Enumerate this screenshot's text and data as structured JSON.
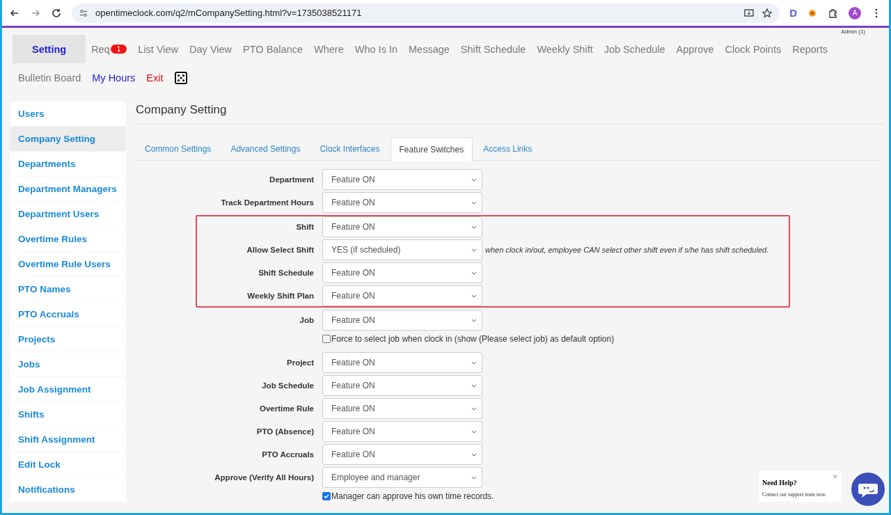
{
  "browser": {
    "url": "opentimeclock.com/q2/mCompanySetting.html?v=1735038521171",
    "extension_letter": "D",
    "avatar_letter": "A"
  },
  "account": "Admin (1)",
  "nav": [
    {
      "label": "Setting",
      "selected": true,
      "kind": "tab"
    },
    {
      "label": "Req",
      "selected": false,
      "kind": "tab",
      "badge": "1"
    },
    {
      "label": "List View",
      "selected": false,
      "kind": "tab"
    },
    {
      "label": "Day View",
      "selected": false,
      "kind": "tab"
    },
    {
      "label": "PTO Balance",
      "selected": false,
      "kind": "tab"
    },
    {
      "label": "Where",
      "selected": false,
      "kind": "tab"
    },
    {
      "label": "Who Is In",
      "selected": false,
      "kind": "tab"
    },
    {
      "label": "Message",
      "selected": false,
      "kind": "tab"
    },
    {
      "label": "Shift Schedule",
      "selected": false,
      "kind": "tab"
    },
    {
      "label": "Weekly Shift",
      "selected": false,
      "kind": "tab"
    },
    {
      "label": "Job Schedule",
      "selected": false,
      "kind": "tab"
    },
    {
      "label": "Approve",
      "selected": false,
      "kind": "tab"
    },
    {
      "label": "Clock Points",
      "selected": false,
      "kind": "tab"
    },
    {
      "label": "Reports",
      "selected": false,
      "kind": "tab"
    },
    {
      "label": "Bulletin Board",
      "selected": false,
      "kind": "tab"
    },
    {
      "label": "My Hours",
      "selected": false,
      "kind": "mine"
    },
    {
      "label": "Exit",
      "selected": false,
      "kind": "exit"
    },
    {
      "kind": "icon",
      "selected": false
    }
  ],
  "sidebar": {
    "items": [
      {
        "label": "Users",
        "selected": false
      },
      {
        "label": "Company Setting",
        "selected": true
      },
      {
        "label": "Departments",
        "selected": false
      },
      {
        "label": "Department Managers",
        "selected": false
      },
      {
        "label": "Department Users",
        "selected": false
      },
      {
        "label": "Overtime Rules",
        "selected": false
      },
      {
        "label": "Overtime Rule Users",
        "selected": false
      },
      {
        "label": "PTO Names",
        "selected": false
      },
      {
        "label": "PTO Accruals",
        "selected": false
      },
      {
        "label": "Projects",
        "selected": false
      },
      {
        "label": "Jobs",
        "selected": false
      },
      {
        "label": "Job Assignment",
        "selected": false
      },
      {
        "label": "Shifts",
        "selected": false
      },
      {
        "label": "Shift Assignment",
        "selected": false
      },
      {
        "label": "Edit Lock",
        "selected": false
      },
      {
        "label": "Notifications",
        "selected": false
      }
    ]
  },
  "page_title": "Company Setting",
  "tabs": [
    {
      "label": "Common Settings",
      "selected": false
    },
    {
      "label": "Advanced Settings",
      "selected": false
    },
    {
      "label": "Clock Interfaces",
      "selected": false
    },
    {
      "label": "Feature Switches",
      "selected": true
    },
    {
      "label": "Access Links",
      "selected": false
    }
  ],
  "sections": [
    {
      "highlighted": false,
      "rows": [
        {
          "kind": "select",
          "label": "Department",
          "value": "Feature ON"
        },
        {
          "kind": "select",
          "label": "Track Department Hours",
          "value": "Feature ON"
        }
      ]
    },
    {
      "highlighted": true,
      "rows": [
        {
          "kind": "select",
          "label": "Shift",
          "value": "Feature ON"
        },
        {
          "kind": "select",
          "label": "Allow Select Shift",
          "value": "YES (if scheduled)",
          "note": "when clock in/out, employee CAN select other shift even if s/he has shift scheduled."
        },
        {
          "kind": "select",
          "label": "Shift Schedule",
          "value": "Feature ON"
        },
        {
          "kind": "select",
          "label": "Weekly Shift Plan",
          "value": "Feature ON"
        }
      ]
    },
    {
      "highlighted": false,
      "rows": [
        {
          "kind": "select",
          "label": "Job",
          "value": "Feature ON"
        },
        {
          "kind": "checkbox",
          "label": "Force to select job when clock in (show (Please select job) as default option)",
          "checked": false
        },
        {
          "kind": "select",
          "label": "Project",
          "value": "Feature ON"
        },
        {
          "kind": "select",
          "label": "Job Schedule",
          "value": "Feature ON"
        },
        {
          "kind": "select",
          "label": "Overtime Rule",
          "value": "Feature ON"
        },
        {
          "kind": "select",
          "label": "PTO (Absence)",
          "value": "Feature ON"
        },
        {
          "kind": "select",
          "label": "PTO Accruals",
          "value": "Feature ON"
        },
        {
          "kind": "select",
          "label": "Approve (Verify All Hours)",
          "value": "Employee and manager"
        },
        {
          "kind": "checkbox",
          "label": "Manager can approve his own time records.",
          "checked": true
        }
      ]
    }
  ],
  "help": {
    "title": "Need Help?",
    "text": "Contact our support team now.",
    "close": "×"
  }
}
